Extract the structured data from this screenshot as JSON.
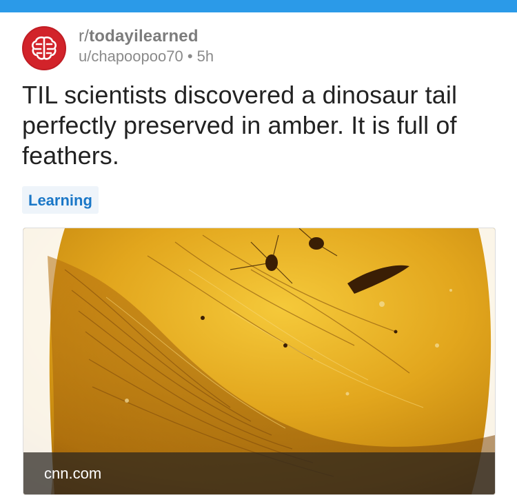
{
  "theme": {
    "top_bar_color": "#2b9ae8",
    "avatar_color": "#d2232a",
    "flair_color": "#1a77c7"
  },
  "post": {
    "subreddit_prefix": "r/",
    "subreddit_name": "todayilearned",
    "author": "u/chapoopoo70",
    "separator": "•",
    "age": "5h",
    "title": "TIL scientists discovered a dinosaur tail perfectly preserved in amber. It is full of feathers.",
    "flair": "Learning",
    "link_domain": "cnn.com",
    "avatar_icon": "brain-icon",
    "image_subject": "amber-with-feathered-tail-image"
  }
}
